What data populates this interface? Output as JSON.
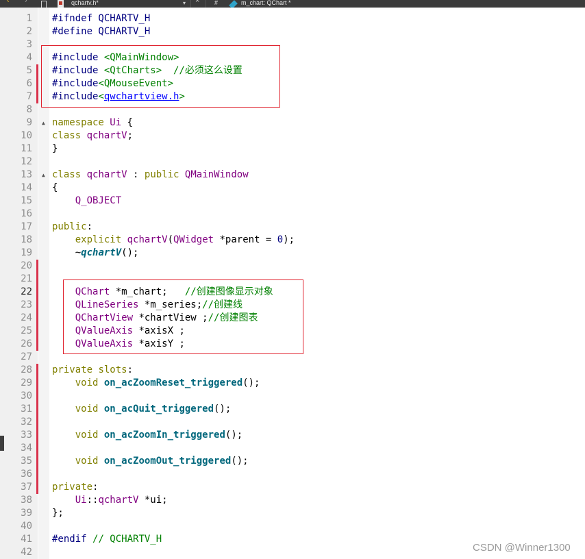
{
  "tabbar": {
    "back_glyph": "‹",
    "forward_glyph": "›",
    "file_name": "qchartv.h*",
    "dropdown_glyph": "▾",
    "close_glyph": "×",
    "hash": "#",
    "symbol": "m_chart: QChart *"
  },
  "lines": [
    {
      "n": "1",
      "t": [
        [
          "pp",
          "#ifndef QCHARTV_H"
        ]
      ]
    },
    {
      "n": "2",
      "t": [
        [
          "pp",
          "#define QCHARTV_H"
        ]
      ]
    },
    {
      "n": "3",
      "t": []
    },
    {
      "n": "4",
      "t": [
        [
          "pp",
          "#include "
        ],
        [
          "str",
          "<QMainWindow>"
        ]
      ]
    },
    {
      "n": "5",
      "t": [
        [
          "pp",
          "#include "
        ],
        [
          "str",
          "<QtCharts>"
        ],
        [
          "",
          "  "
        ],
        [
          "cmt",
          "//必须这么设置"
        ]
      ]
    },
    {
      "n": "6",
      "t": [
        [
          "pp",
          "#include"
        ],
        [
          "str",
          "<QMouseEvent>"
        ]
      ]
    },
    {
      "n": "7",
      "t": [
        [
          "pp",
          "#include"
        ],
        [
          "str",
          "<"
        ],
        [
          "link",
          "qwchartview.h"
        ],
        [
          "str",
          ">"
        ]
      ]
    },
    {
      "n": "8",
      "t": []
    },
    {
      "n": "9",
      "t": [
        [
          "kw",
          "namespace"
        ],
        [
          "",
          " "
        ],
        [
          "type",
          "Ui"
        ],
        [
          "",
          " {"
        ]
      ]
    },
    {
      "n": "10",
      "t": [
        [
          "kw",
          "class"
        ],
        [
          "",
          " "
        ],
        [
          "type",
          "qchartV"
        ],
        [
          "",
          ";"
        ]
      ]
    },
    {
      "n": "11",
      "t": [
        [
          "",
          "}"
        ]
      ]
    },
    {
      "n": "12",
      "t": []
    },
    {
      "n": "13",
      "t": [
        [
          "kw",
          "class"
        ],
        [
          "",
          " "
        ],
        [
          "type",
          "qchartV"
        ],
        [
          "",
          " : "
        ],
        [
          "kw",
          "public"
        ],
        [
          "",
          " "
        ],
        [
          "type",
          "QMainWindow"
        ]
      ]
    },
    {
      "n": "14",
      "t": [
        [
          "",
          "{"
        ]
      ]
    },
    {
      "n": "15",
      "t": [
        [
          "",
          "    "
        ],
        [
          "type",
          "Q_OBJECT"
        ]
      ]
    },
    {
      "n": "16",
      "t": []
    },
    {
      "n": "17",
      "t": [
        [
          "kw",
          "public"
        ],
        [
          "",
          ":"
        ]
      ]
    },
    {
      "n": "18",
      "t": [
        [
          "",
          "    "
        ],
        [
          "kw",
          "explicit"
        ],
        [
          "",
          " "
        ],
        [
          "type",
          "qchartV"
        ],
        [
          "",
          "("
        ],
        [
          "type",
          "QWidget"
        ],
        [
          "",
          " *parent = "
        ],
        [
          "num",
          "0"
        ],
        [
          "",
          ");"
        ]
      ]
    },
    {
      "n": "19",
      "t": [
        [
          "",
          "    ~"
        ],
        [
          "fn-it",
          "qchartV"
        ],
        [
          "",
          "();"
        ]
      ]
    },
    {
      "n": "20",
      "t": []
    },
    {
      "n": "21",
      "t": []
    },
    {
      "n": "22",
      "t": [
        [
          "",
          "    "
        ],
        [
          "type",
          "QChart"
        ],
        [
          "",
          " *m_chart;   "
        ],
        [
          "cmt",
          "//创建图像显示对象"
        ]
      ]
    },
    {
      "n": "23",
      "t": [
        [
          "",
          "    "
        ],
        [
          "type",
          "QLineSeries"
        ],
        [
          "",
          " *m_series;"
        ],
        [
          "cmt",
          "//创建线"
        ]
      ]
    },
    {
      "n": "24",
      "t": [
        [
          "",
          "    "
        ],
        [
          "type",
          "QChartView"
        ],
        [
          "",
          " *chartView ;"
        ],
        [
          "cmt",
          "//创建图表"
        ]
      ]
    },
    {
      "n": "25",
      "t": [
        [
          "",
          "    "
        ],
        [
          "type",
          "QValueAxis"
        ],
        [
          "",
          " *axisX ;"
        ]
      ]
    },
    {
      "n": "26",
      "t": [
        [
          "",
          "    "
        ],
        [
          "type",
          "QValueAxis"
        ],
        [
          "",
          " *axisY ;"
        ]
      ]
    },
    {
      "n": "27",
      "t": []
    },
    {
      "n": "28",
      "t": [
        [
          "kw",
          "private"
        ],
        [
          "",
          " "
        ],
        [
          "kw",
          "slots"
        ],
        [
          "",
          ":"
        ]
      ]
    },
    {
      "n": "29",
      "t": [
        [
          "",
          "    "
        ],
        [
          "kw",
          "void"
        ],
        [
          "",
          " "
        ],
        [
          "fn",
          "on_acZoomReset_triggered"
        ],
        [
          "",
          "();"
        ]
      ]
    },
    {
      "n": "30",
      "t": []
    },
    {
      "n": "31",
      "t": [
        [
          "",
          "    "
        ],
        [
          "kw",
          "void"
        ],
        [
          "",
          " "
        ],
        [
          "fn",
          "on_acQuit_triggered"
        ],
        [
          "",
          "();"
        ]
      ]
    },
    {
      "n": "32",
      "t": []
    },
    {
      "n": "33",
      "t": [
        [
          "",
          "    "
        ],
        [
          "kw",
          "void"
        ],
        [
          "",
          " "
        ],
        [
          "fn",
          "on_acZoomIn_triggered"
        ],
        [
          "",
          "();"
        ]
      ]
    },
    {
      "n": "34",
      "t": []
    },
    {
      "n": "35",
      "t": [
        [
          "",
          "    "
        ],
        [
          "kw",
          "void"
        ],
        [
          "",
          " "
        ],
        [
          "fn",
          "on_acZoomOut_triggered"
        ],
        [
          "",
          "();"
        ]
      ]
    },
    {
      "n": "36",
      "t": []
    },
    {
      "n": "37",
      "t": [
        [
          "kw",
          "private"
        ],
        [
          "",
          ":"
        ]
      ]
    },
    {
      "n": "38",
      "t": [
        [
          "",
          "    "
        ],
        [
          "type",
          "Ui"
        ],
        [
          "",
          "::"
        ],
        [
          "type",
          "qchartV"
        ],
        [
          "",
          " *ui;"
        ]
      ]
    },
    {
      "n": "39",
      "t": [
        [
          "",
          "};"
        ]
      ]
    },
    {
      "n": "40",
      "t": []
    },
    {
      "n": "41",
      "t": [
        [
          "pp",
          "#endif"
        ],
        [
          "",
          " "
        ],
        [
          "cmt",
          "// QCHARTV_H"
        ]
      ]
    },
    {
      "n": "42",
      "t": []
    }
  ],
  "current_line": "22",
  "fold_lines": [
    "9",
    "13"
  ],
  "watermark": "CSDN @Winner1300",
  "colors": {
    "change_bar": "#d9304a",
    "annotation_box": "#e0222e",
    "keyword": "#808000",
    "type": "#800080",
    "string": "#008000"
  }
}
